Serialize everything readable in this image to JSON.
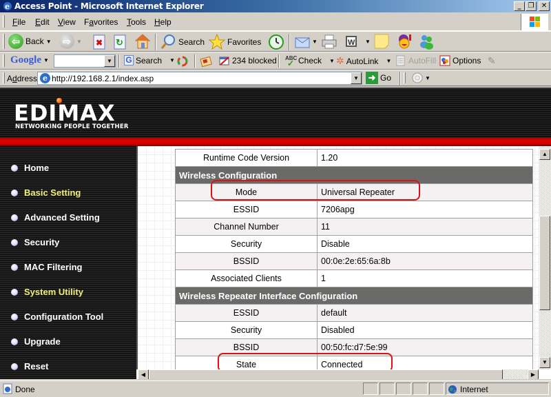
{
  "window": {
    "title": "Access Point - Microsoft Internet Explorer",
    "controls": [
      "minimize",
      "restore",
      "close"
    ]
  },
  "menu": {
    "items": [
      {
        "label": "File",
        "accel": "F"
      },
      {
        "label": "Edit",
        "accel": "E"
      },
      {
        "label": "View",
        "accel": "V"
      },
      {
        "label": "Favorites",
        "accel": "a"
      },
      {
        "label": "Tools",
        "accel": "T"
      },
      {
        "label": "Help",
        "accel": "H"
      }
    ]
  },
  "toolbar": {
    "back_label": "Back",
    "search_label": "Search",
    "favorites_label": "Favorites"
  },
  "google_bar": {
    "brand": "Google",
    "search_value": "",
    "search_label": "Search",
    "blocked_label": "234 blocked",
    "check_label": "Check",
    "autolink_label": "AutoLink",
    "autofill_label": "AutoFill",
    "options_label": "Options"
  },
  "address_bar": {
    "label": "Address",
    "url": "http://192.168.2.1/index.asp",
    "go_label": "Go"
  },
  "brand": {
    "logo": "EDIMAX",
    "tagline": "NETWORKING PEOPLE TOGETHER"
  },
  "sidebar": {
    "items": [
      {
        "label": "Home",
        "highlighted": false
      },
      {
        "label": "Basic Setting",
        "highlighted": true
      },
      {
        "label": "Advanced Setting",
        "highlighted": false
      },
      {
        "label": "Security",
        "highlighted": false
      },
      {
        "label": "MAC Filtering",
        "highlighted": false
      },
      {
        "label": "System Utility",
        "highlighted": true
      },
      {
        "label": "Configuration Tool",
        "highlighted": false
      },
      {
        "label": "Upgrade",
        "highlighted": false
      },
      {
        "label": "Reset",
        "highlighted": false
      }
    ]
  },
  "status_table": {
    "rows": [
      {
        "type": "row",
        "label": "Runtime Code Version",
        "value": "1.20"
      },
      {
        "type": "section",
        "label": "Wireless Configuration"
      },
      {
        "type": "row",
        "label": "Mode",
        "value": "Universal Repeater",
        "circled": true
      },
      {
        "type": "row",
        "label": "ESSID",
        "value": "7206apg"
      },
      {
        "type": "row",
        "label": "Channel Number",
        "value": "11"
      },
      {
        "type": "row",
        "label": "Security",
        "value": "Disable"
      },
      {
        "type": "row",
        "label": "BSSID",
        "value": "00:0e:2e:65:6a:8b"
      },
      {
        "type": "row",
        "label": "Associated Clients",
        "value": "1"
      },
      {
        "type": "section",
        "label": "Wireless Repeater Interface Configuration"
      },
      {
        "type": "row",
        "label": "ESSID",
        "value": "default"
      },
      {
        "type": "row",
        "label": "Security",
        "value": "Disabled"
      },
      {
        "type": "row",
        "label": "BSSID",
        "value": "00:50:fc:d7:5e:99"
      },
      {
        "type": "row",
        "label": "State",
        "value": "Connected",
        "circled": true
      }
    ]
  },
  "statusbar": {
    "text": "Done",
    "zone": "Internet"
  },
  "colors": {
    "accent_red": "#e01010",
    "nav_highlight": "#f0f07a",
    "section_header": "#6a6a68"
  }
}
